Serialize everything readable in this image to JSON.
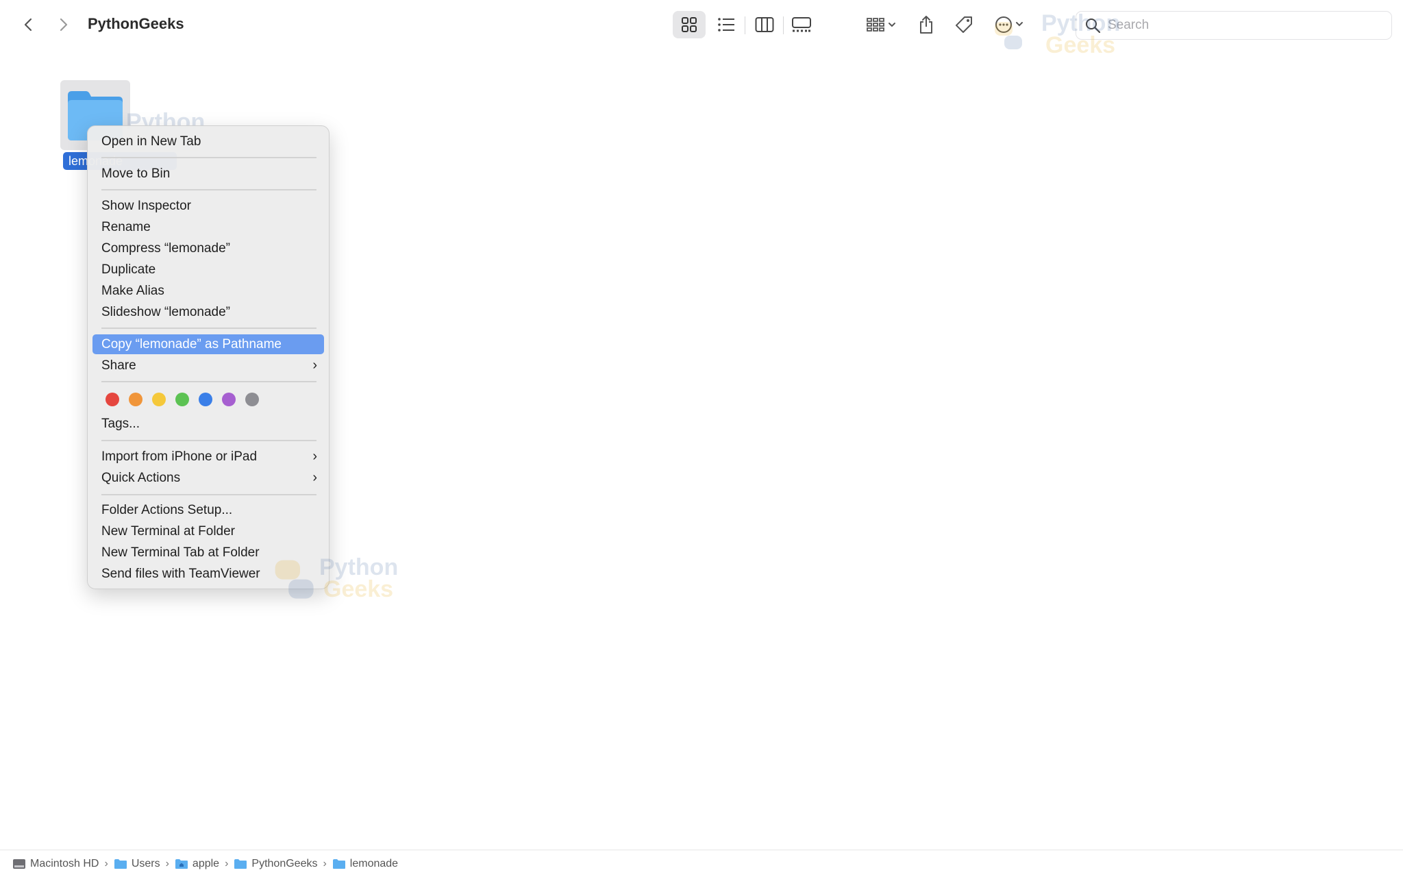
{
  "window": {
    "title": "PythonGeeks"
  },
  "toolbar": {
    "back_icon": "chevron-left-icon",
    "forward_icon": "chevron-right-icon",
    "views": [
      "icon-view",
      "list-view",
      "column-view",
      "gallery-view"
    ],
    "active_view": "icon-view",
    "group_icon": "group-grid-icon",
    "share_icon": "share-icon",
    "tag_icon": "tag-icon",
    "more_icon": "ellipsis-circle-icon"
  },
  "search": {
    "placeholder": "Search"
  },
  "folder": {
    "name": "lemonade",
    "visible_label": "lem",
    "color": "#5aaef0"
  },
  "context_menu": {
    "open_new_tab": "Open in New Tab",
    "move_to_bin": "Move to Bin",
    "show_inspector": "Show Inspector",
    "rename": "Rename",
    "compress": "Compress “lemonade”",
    "duplicate": "Duplicate",
    "make_alias": "Make Alias",
    "slideshow": "Slideshow “lemonade”",
    "copy_pathname": "Copy “lemonade” as Pathname",
    "share": "Share",
    "tags": "Tags...",
    "import_iphone": "Import from iPhone or iPad",
    "quick_actions": "Quick Actions",
    "folder_actions": "Folder Actions Setup...",
    "new_terminal": "New Terminal at Folder",
    "new_terminal_tab": "New Terminal Tab at Folder",
    "teamviewer": "Send files with TeamViewer",
    "highlighted_item": "copy_pathname",
    "tag_colors": [
      "#e5463f",
      "#f0953a",
      "#f5c83a",
      "#5cc253",
      "#3a7fe8",
      "#a65fd0",
      "#8e8e93"
    ]
  },
  "watermark": {
    "line1": "Python",
    "line2": "Geeks"
  },
  "pathbar": {
    "crumbs": [
      "Macintosh HD",
      "Users",
      "apple",
      "PythonGeeks",
      "lemonade"
    ],
    "separator": "›"
  }
}
